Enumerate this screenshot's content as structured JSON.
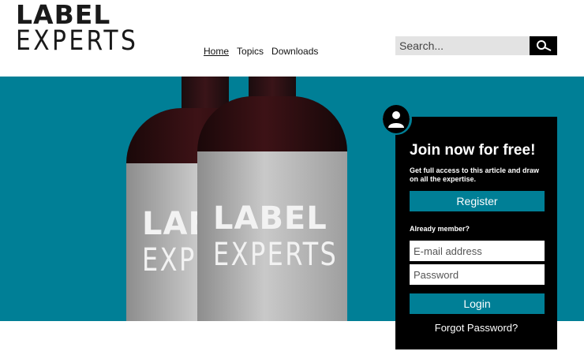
{
  "logo": {
    "line1": "LABEL",
    "line2": "EXPERTS"
  },
  "nav": {
    "items": [
      "Home",
      "Topics",
      "Downloads"
    ],
    "active": "Home"
  },
  "search": {
    "placeholder": "Search...",
    "icon": "search-icon"
  },
  "hero": {
    "bottle_label_line1": "LABEL",
    "bottle_label_line2": "EXPERTS",
    "background_color": "#007f96"
  },
  "join_panel": {
    "avatar_icon": "user-icon",
    "title": "Join now for free!",
    "description": "Get full access to this article and draw on all the expertise.",
    "register_label": "Register",
    "already_member": "Already member?",
    "email_placeholder": "E-mail address",
    "password_placeholder": "Password",
    "login_label": "Login",
    "forgot_label": "Forgot Password?",
    "accent_color": "#007f96"
  }
}
